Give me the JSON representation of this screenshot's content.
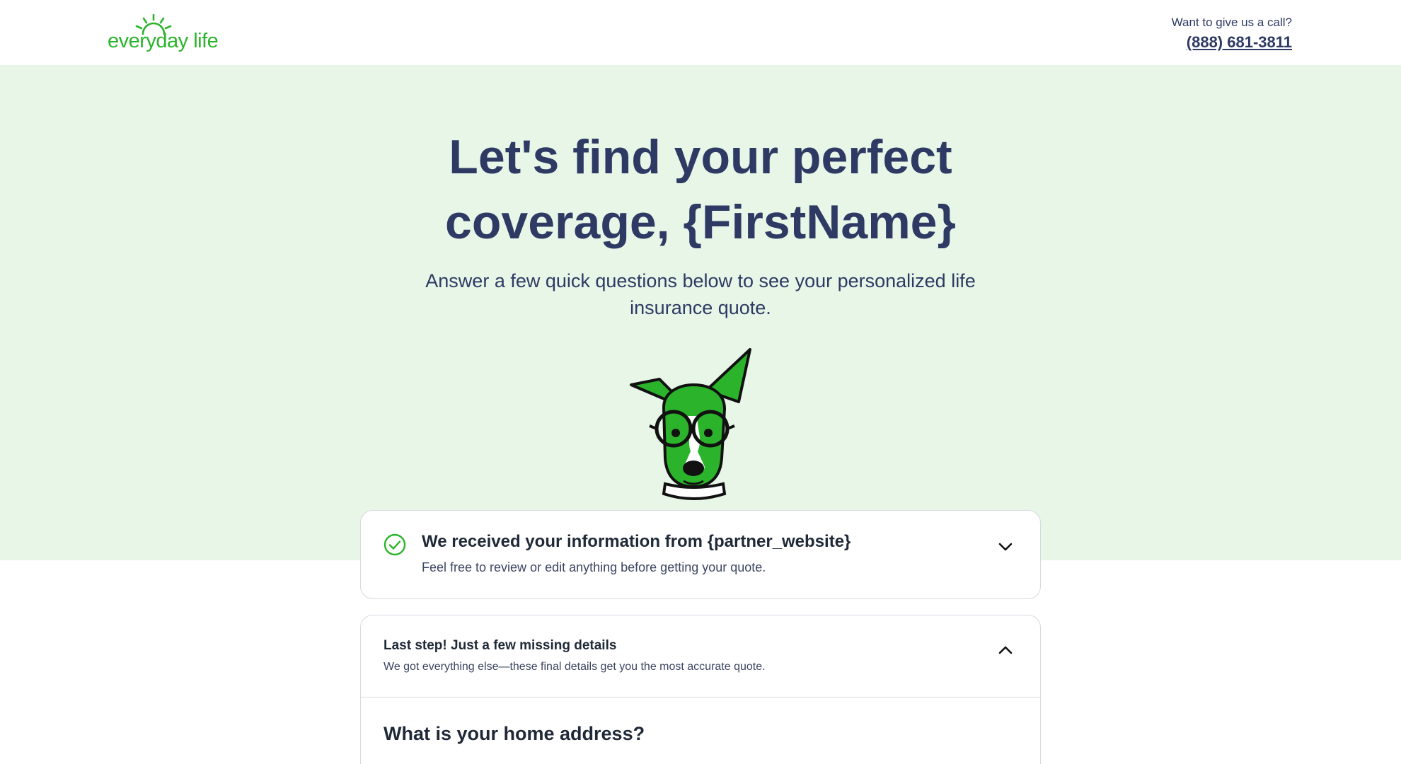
{
  "brand": {
    "logo_text": "everyday life",
    "accent_color": "#2bb42b",
    "text_color": "#2e3a63",
    "hero_bg": "#e8f6e8"
  },
  "header": {
    "call_label": "Want to give us a call?",
    "phone": "(888) 681-3811"
  },
  "hero": {
    "title": "Let's find your perfect coverage, {FirstName}",
    "subtitle": "Answer a few quick questions below to see your personalized life insurance quote.",
    "mascot_icon": "dog-mascot-icon"
  },
  "received_card": {
    "icon": "check-circle-icon",
    "title": "We received your information from {partner_website}",
    "subtitle": "Feel free to review or edit anything before getting your quote.",
    "toggle_icon": "chevron-down-icon"
  },
  "missing_card": {
    "title": "Last step! Just a few missing details",
    "subtitle": "We got everything else—these final details get you the most accurate quote.",
    "toggle_icon": "chevron-up-icon",
    "question": "What is your home address?"
  }
}
